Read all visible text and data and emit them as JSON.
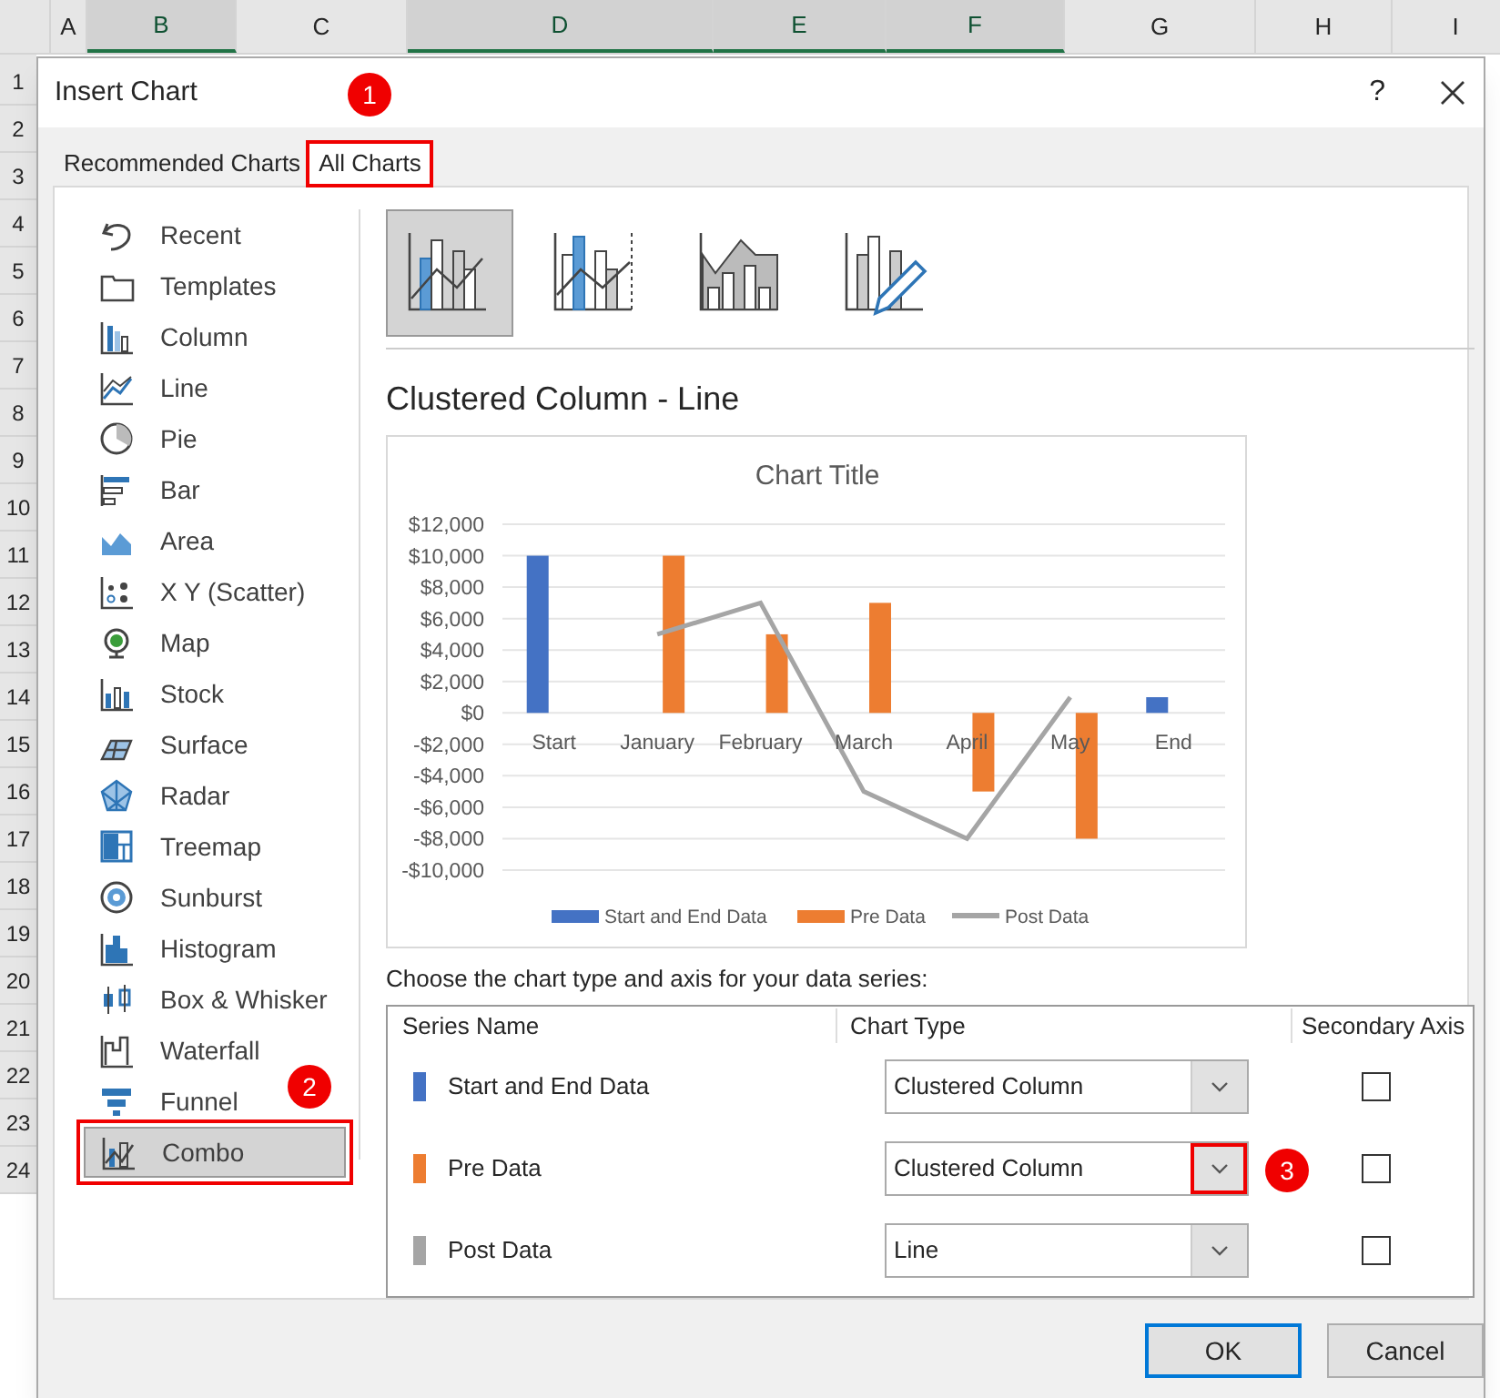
{
  "spreadsheet": {
    "columns": [
      {
        "label": "A",
        "selected": false
      },
      {
        "label": "B",
        "selected": true
      },
      {
        "label": "C",
        "selected": false
      },
      {
        "label": "D",
        "selected": true
      },
      {
        "label": "E",
        "selected": true
      },
      {
        "label": "F",
        "selected": true
      },
      {
        "label": "G",
        "selected": false
      },
      {
        "label": "H",
        "selected": false
      },
      {
        "label": "I",
        "selected": false
      }
    ],
    "rows": [
      "1",
      "2",
      "3",
      "4",
      "5",
      "6",
      "7",
      "8",
      "9",
      "10",
      "11",
      "12",
      "13",
      "14",
      "15",
      "16",
      "17",
      "18",
      "19",
      "20",
      "21",
      "22",
      "23",
      "24"
    ]
  },
  "dialog": {
    "title": "Insert Chart",
    "help": "?",
    "tabs": [
      {
        "label": "Recommended Charts",
        "selected": false,
        "highlighted": false
      },
      {
        "label": "All Charts",
        "selected": true,
        "highlighted": true,
        "callout": "1"
      }
    ],
    "sidebar": {
      "items": [
        {
          "label": "Recent",
          "selected": false,
          "highlighted": false
        },
        {
          "label": "Templates",
          "selected": false,
          "highlighted": false
        },
        {
          "label": "Column",
          "selected": false,
          "highlighted": false
        },
        {
          "label": "Line",
          "selected": false,
          "highlighted": false
        },
        {
          "label": "Pie",
          "selected": false,
          "highlighted": false
        },
        {
          "label": "Bar",
          "selected": false,
          "highlighted": false
        },
        {
          "label": "Area",
          "selected": false,
          "highlighted": false
        },
        {
          "label": "X Y (Scatter)",
          "selected": false,
          "highlighted": false
        },
        {
          "label": "Map",
          "selected": false,
          "highlighted": false
        },
        {
          "label": "Stock",
          "selected": false,
          "highlighted": false
        },
        {
          "label": "Surface",
          "selected": false,
          "highlighted": false
        },
        {
          "label": "Radar",
          "selected": false,
          "highlighted": false
        },
        {
          "label": "Treemap",
          "selected": false,
          "highlighted": false
        },
        {
          "label": "Sunburst",
          "selected": false,
          "highlighted": false
        },
        {
          "label": "Histogram",
          "selected": false,
          "highlighted": false
        },
        {
          "label": "Box & Whisker",
          "selected": false,
          "highlighted": false
        },
        {
          "label": "Waterfall",
          "selected": false,
          "highlighted": false
        },
        {
          "label": "Funnel",
          "selected": false,
          "highlighted": false,
          "callout": "2"
        },
        {
          "label": "Combo",
          "selected": true,
          "highlighted": true
        }
      ]
    },
    "subtypes": [
      {
        "selected": true
      },
      {
        "selected": false
      },
      {
        "selected": false
      },
      {
        "selected": false
      }
    ],
    "subtype_title": "Clustered Column - Line",
    "chart_data": {
      "type": "bar",
      "title": "Chart Title",
      "categories": [
        "Start",
        "January",
        "February",
        "March",
        "April",
        "May",
        "End"
      ],
      "series": [
        {
          "name": "Start and End Data",
          "color": "#4472c4",
          "type": "bar",
          "values": [
            10000,
            null,
            null,
            null,
            null,
            null,
            1000
          ]
        },
        {
          "name": "Pre Data",
          "color": "#ed7d31",
          "type": "bar",
          "values": [
            null,
            10000,
            5000,
            7000,
            -5000,
            -8000,
            null
          ]
        },
        {
          "name": "Post Data",
          "color": "#a5a5a5",
          "type": "line",
          "values": [
            null,
            5000,
            7000,
            -5000,
            -8000,
            1000,
            null
          ]
        }
      ],
      "stacked": false,
      "grid": true,
      "legend": "bottom",
      "ylim": [
        -10000,
        12000
      ],
      "yticks": [
        {
          "value": -10000,
          "label": "-$10,000"
        },
        {
          "value": -8000,
          "label": "-$8,000"
        },
        {
          "value": -6000,
          "label": "-$6,000"
        },
        {
          "value": -4000,
          "label": "-$4,000"
        },
        {
          "value": -2000,
          "label": "-$2,000"
        },
        {
          "value": 0,
          "label": "$0"
        },
        {
          "value": 2000,
          "label": "$2,000"
        },
        {
          "value": 4000,
          "label": "$4,000"
        },
        {
          "value": 6000,
          "label": "$6,000"
        },
        {
          "value": 8000,
          "label": "$8,000"
        },
        {
          "value": 10000,
          "label": "$10,000"
        },
        {
          "value": 12000,
          "label": "$12,000"
        }
      ]
    },
    "series_prompt": "Choose the chart type and axis for your data series:",
    "series_table": {
      "columns": [
        "Series Name",
        "Chart Type",
        "Secondary Axis"
      ],
      "rows": [
        {
          "name": "Start and End Data",
          "color": "#4472c4",
          "chart_type": "Clustered Column",
          "secondary_axis": false,
          "highlighted": false
        },
        {
          "name": "Pre Data",
          "color": "#ed7d31",
          "chart_type": "Clustered Column",
          "secondary_axis": false,
          "highlighted": true,
          "callout": "3"
        },
        {
          "name": "Post Data",
          "color": "#a5a5a5",
          "chart_type": "Line",
          "secondary_axis": false,
          "highlighted": false
        }
      ]
    },
    "buttons": [
      {
        "label": "OK",
        "default": true
      },
      {
        "label": "Cancel",
        "default": false
      }
    ]
  }
}
